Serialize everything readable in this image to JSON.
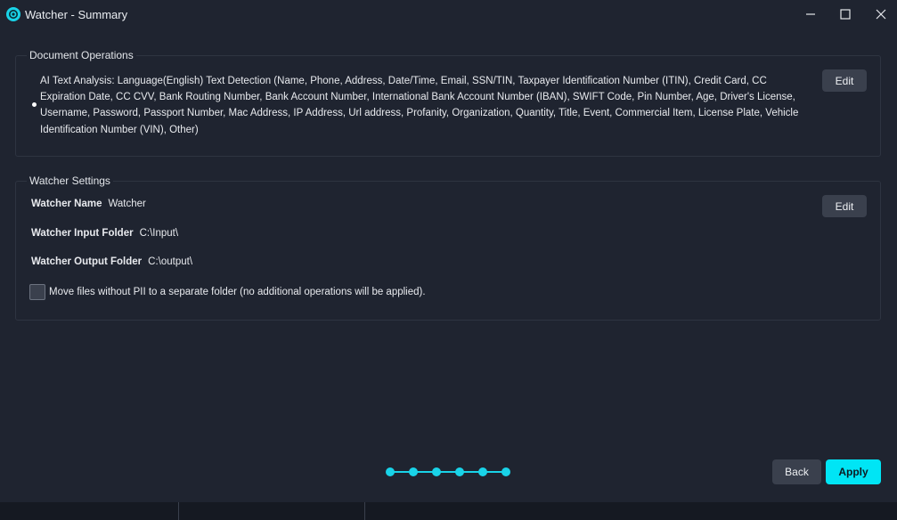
{
  "window": {
    "title": "Watcher - Summary",
    "accent": "#19d3e8",
    "controls": [
      "minimize-icon",
      "maximize-icon",
      "close-icon"
    ]
  },
  "document_operations": {
    "legend": "Document Operations",
    "item": "AI Text Analysis: Language(English) Text Detection (Name, Phone, Address, Date/Time, Email, SSN/TIN, Taxpayer Identification Number (ITIN), Credit Card, CC Expiration Date, CC CVV, Bank Routing Number, Bank Account Number, International Bank Account Number (IBAN), SWIFT Code, Pin Number, Age, Driver's License, Username, Password, Passport Number, Mac Address, IP Address, Url address, Profanity, Organization, Quantity, Title, Event, Commercial Item, License Plate, Vehicle Identification Number (VIN), Other)",
    "edit_label": "Edit"
  },
  "watcher_settings": {
    "legend": "Watcher Settings",
    "edit_label": "Edit",
    "name_label": "Watcher Name",
    "name_value": "Watcher",
    "input_label": "Watcher Input Folder",
    "input_value": "C:\\Input\\",
    "output_label": "Watcher Output Folder",
    "output_value": "C:\\output\\",
    "move_files_label": "Move files without PII to a separate folder (no additional operations will be applied).",
    "move_files_checked": false
  },
  "stepper": {
    "steps": 6,
    "completed": 6
  },
  "footer": {
    "back_label": "Back",
    "apply_label": "Apply"
  }
}
